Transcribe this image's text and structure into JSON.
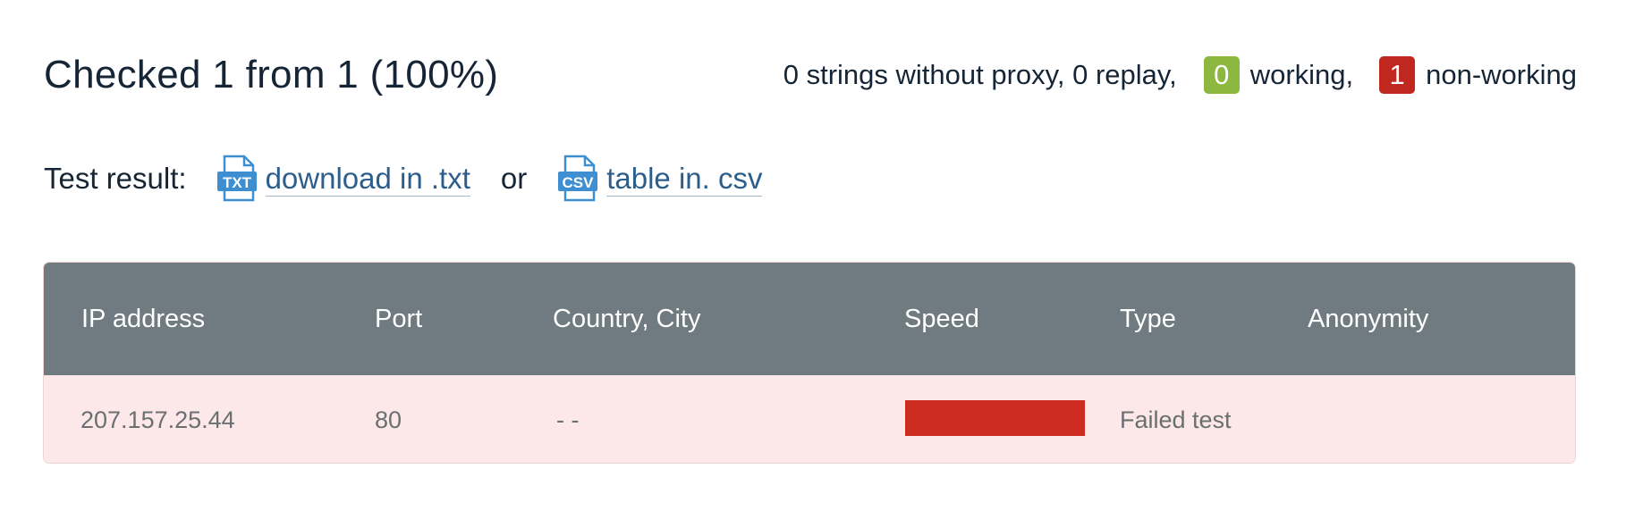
{
  "header": {
    "title": "Checked 1 from 1 (100%)",
    "summary_text": "0 strings without proxy, 0 replay,",
    "working_count": "0",
    "working_label": "working,",
    "nonworking_count": "1",
    "nonworking_label": "non-working"
  },
  "results": {
    "label": "Test result:",
    "txt_icon_text": "TXT",
    "txt_link": "download in .txt",
    "or": "or",
    "csv_icon_text": "CSV",
    "csv_link": "table in. csv"
  },
  "table": {
    "columns": [
      "IP address",
      "Port",
      "Country, City",
      "Speed",
      "Type",
      "Anonymity"
    ],
    "rows": [
      {
        "ip": "207.157.25.44",
        "port": "80",
        "country_city": "- -",
        "speed_status": "failed",
        "type": "Failed test",
        "anonymity": ""
      }
    ]
  },
  "colors": {
    "working_badge": "#8db83f",
    "nonworking_badge": "#c0281f",
    "table_header": "#6f7b80",
    "failed_row": "#fce8e8",
    "speed_bar_failed": "#cd2a20",
    "link": "#2b5e8c",
    "icon_blue": "#3d8fd1"
  },
  "icons": {
    "txt": "txt-file-icon",
    "csv": "csv-file-icon"
  }
}
